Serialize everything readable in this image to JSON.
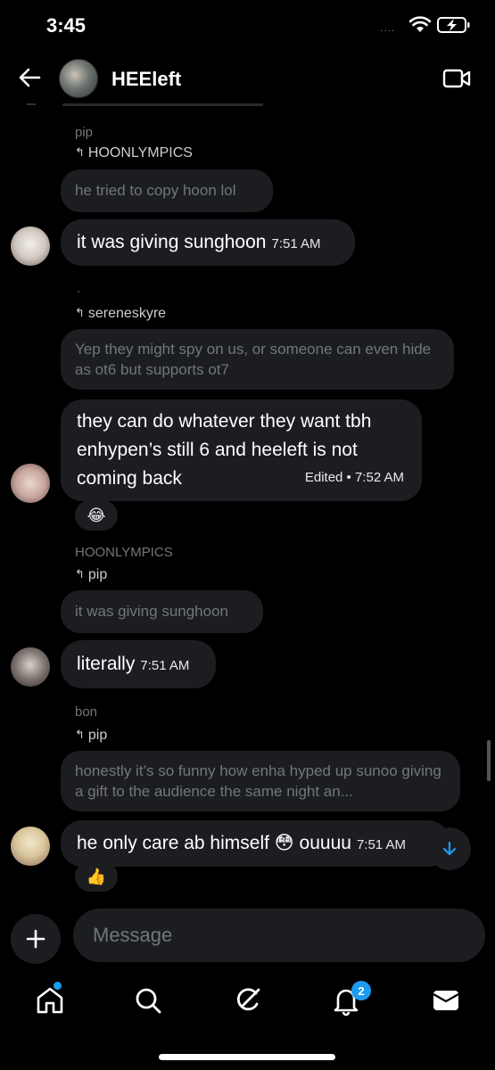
{
  "status": {
    "time": "3:45",
    "signal": "....",
    "battery_icon": "battery-charging-icon"
  },
  "header": {
    "title": "HEEleft",
    "back_icon": "back-arrow-icon",
    "video_icon": "video-call-icon"
  },
  "messages": [
    {
      "sender": "pip",
      "reply_to": "HOONLYMPICS",
      "quote": "he tried to copy hoon lol",
      "text": "it was giving sunghoon",
      "time": "7:51 AM"
    },
    {
      "sender": ".",
      "reply_to": "sereneskyre",
      "quote": "Yep they might spy on us, or someone can even hide as ot6 but supports ot7",
      "text": "they can do whatever they want tbh enhypen’s still 6 and heeleft is not coming back",
      "time": "Edited • 7:52 AM",
      "reaction": "😂"
    },
    {
      "sender": "HOONLYMPICS",
      "reply_to": "pip",
      "quote": "it was giving sunghoon",
      "text": "literally",
      "time": "7:51 AM"
    },
    {
      "sender": "bon",
      "reply_to": "pip",
      "quote": "honestly it’s so funny how enha hyped up sunoo giving a gift to the audience the same night an...",
      "text": "he only care ab himself",
      "emoji": "😳",
      "text_tail": "ouuuu",
      "time": "7:51 AM",
      "reaction": "👍"
    }
  ],
  "composer": {
    "placeholder": "Message"
  },
  "nav": {
    "items": [
      "home-icon",
      "search-icon",
      "grok-icon",
      "notifications-icon",
      "messages-icon"
    ],
    "notif_badge": "2"
  },
  "colors": {
    "accent": "#1d9bf0",
    "bubble": "#1c1d21",
    "background": "#000000"
  }
}
